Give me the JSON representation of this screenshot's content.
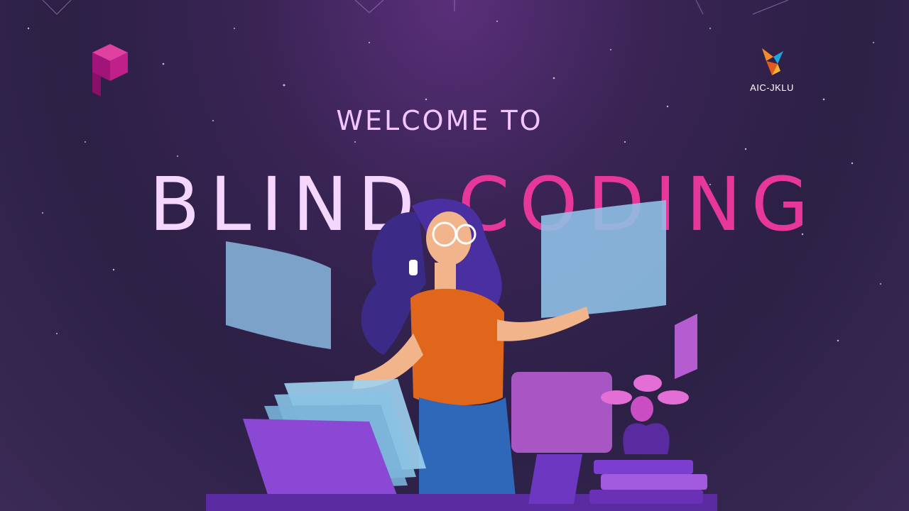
{
  "header": {
    "subtitle": "WELCOME TO",
    "title_word1": "BLIND",
    "title_word2": "CODING",
    "partner_name": "AIC-JKLU"
  },
  "icons": {
    "brand": "cube-logo-icon",
    "partner": "origami-bird-icon"
  },
  "colors": {
    "background": "#2c2045",
    "title_light": "#f4d6ff",
    "title_accent": "#e8379b",
    "brand": "#c0208a"
  }
}
